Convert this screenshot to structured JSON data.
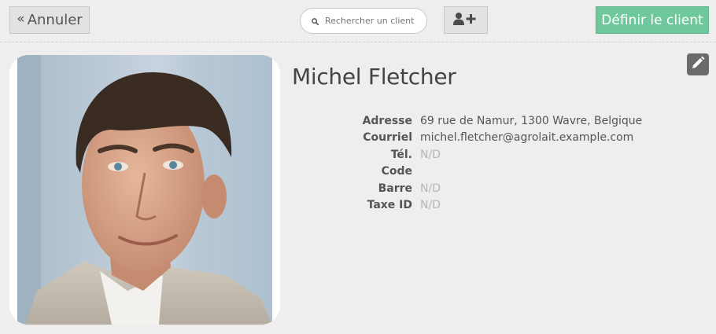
{
  "toolbar": {
    "cancel_label": "Annuler",
    "search_placeholder": "Rechercher un client",
    "set_customer_label": "Définir le client"
  },
  "customer": {
    "name": "Michel Fletcher",
    "fields": [
      {
        "label": "Adresse",
        "value": "69 rue de Namur, 1300 Wavre, Belgique",
        "empty": false
      },
      {
        "label": "Courriel",
        "value": "michel.fletcher@agrolait.example.com",
        "empty": false
      },
      {
        "label": "Tél.",
        "value": "N/D",
        "empty": true
      },
      {
        "label": "Code",
        "value": "",
        "empty": false
      },
      {
        "label": "Barre",
        "value": "N/D",
        "empty": true
      },
      {
        "label": "Taxe ID",
        "value": "N/D",
        "empty": true
      }
    ]
  },
  "icons": {
    "cancel": "double-chevron-left-icon",
    "search": "search-icon",
    "add_user": "add-user-icon",
    "edit": "pencil-icon"
  },
  "colors": {
    "background": "#efeded",
    "primary_button": "#6ec89b",
    "edit_button": "#6b6b6b"
  }
}
